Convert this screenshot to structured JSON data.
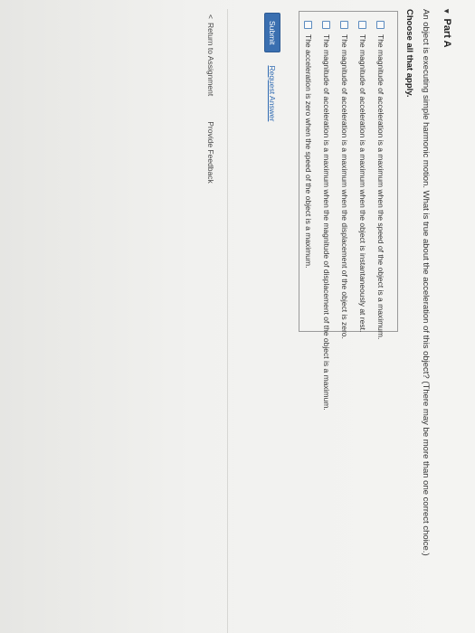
{
  "part": {
    "caret": "▾",
    "title": "Part A"
  },
  "question": {
    "text": "An object is executing simple harmonic motion. What is true about the acceleration of this object? (There may be more than one correct choice.)",
    "instruction": "Choose all that apply."
  },
  "choices": [
    {
      "label": "The magnitude of acceleration is a maximum when the speed of the object is a maximum.",
      "checked": false
    },
    {
      "label": "The magnitude of acceleration is a maximum when the object is instantaneously at rest.",
      "checked": false
    },
    {
      "label": "The magnitude of acceleration is a maximum when the displacement of the object is zero.",
      "checked": false
    },
    {
      "label": "The magnitude of acceleration is a maximum when the magnitude of displacement of the object is a maximum.",
      "checked": false
    },
    {
      "label": "The acceleration is zero when the speed of the object is a maximum.",
      "checked": false
    }
  ],
  "actions": {
    "submit_label": "Submit",
    "request_answer_label": "Request Answer"
  },
  "footer": {
    "back_arrow": "<",
    "return_label": "Return to Assignment",
    "feedback_label": "Provide Feedback"
  },
  "colors": {
    "submit_bg": "#3a6fb0",
    "link": "#2f6ab2",
    "checkbox_border": "#5b8bbf"
  }
}
